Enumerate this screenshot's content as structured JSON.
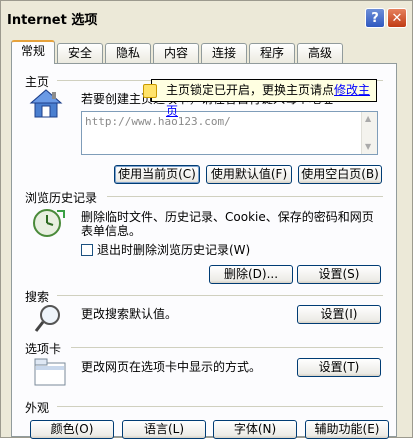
{
  "window": {
    "title": "Internet 选项"
  },
  "titlebar_buttons": {
    "help": "?",
    "close": "✕"
  },
  "tabs": [
    {
      "label": "常规"
    },
    {
      "label": "安全"
    },
    {
      "label": "隐私"
    },
    {
      "label": "内容"
    },
    {
      "label": "连接"
    },
    {
      "label": "程序"
    },
    {
      "label": "高级"
    }
  ],
  "homepage": {
    "section_label": "主页",
    "description": "若要创建主页选项卡，请在各自行键入每个地址",
    "url": "http://www.hao123.com/",
    "tooltip_text": "主页锁定已开启，更换主页请点",
    "tooltip_link": "修改主页",
    "buttons": {
      "use_current": "使用当前页(C)",
      "use_default": "使用默认值(F)",
      "use_blank": "使用空白页(B)"
    }
  },
  "history": {
    "section_label": "浏览历史记录",
    "description_line1": "删除临时文件、历史记录、Cookie、保存的密码和网页",
    "description_line2": "表单信息。",
    "checkbox_label": "退出时删除浏览历史记录(W)",
    "buttons": {
      "delete": "删除(D)...",
      "settings": "设置(S)"
    }
  },
  "search": {
    "section_label": "搜索",
    "description": "更改搜索默认值。",
    "button": "设置(I)"
  },
  "tabs_section": {
    "section_label": "选项卡",
    "description": "更改网页在选项卡中显示的方式。",
    "button": "设置(T)"
  },
  "appearance": {
    "section_label": "外观",
    "buttons": {
      "colors": "颜色(O)",
      "languages": "语言(L)",
      "fonts": "字体(N)",
      "accessibility": "辅助功能(E)"
    }
  },
  "colors": {
    "dialog_bg": "#ece9d8",
    "panel_bg": "#fcfcfe",
    "tooltip_bg": "#ffffe1",
    "link": "#0000ff",
    "active_tab_accent": "#e6a23c"
  }
}
